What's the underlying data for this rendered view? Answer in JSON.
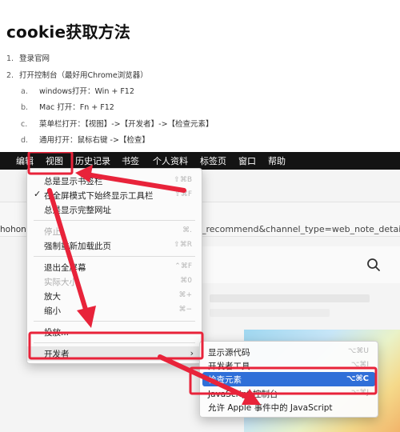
{
  "doc": {
    "title": "cookie获取方法",
    "steps": [
      {
        "num": "1.",
        "text": "登录官网"
      },
      {
        "num": "2.",
        "text": "打开控制台（最好用Chrome浏览器）"
      }
    ],
    "substeps": [
      {
        "num": "a.",
        "text": "windows打开：Win + F12"
      },
      {
        "num": "b.",
        "text": "Mac 打开：Fn + F12"
      },
      {
        "num": "c.",
        "text": "菜单栏打开：【视图】->【开发者】->【检查元素】"
      },
      {
        "num": "d.",
        "text": "通用打开：鼠标右键 ->【检查】"
      }
    ]
  },
  "menubar": {
    "items": [
      "编辑",
      "视图",
      "历史记录",
      "书签",
      "个人资料",
      "标签页",
      "窗口",
      "帮助"
    ]
  },
  "page": {
    "url_left": "hohon",
    "url_right": "_recommend&channel_type=web_note_detail"
  },
  "view_menu": {
    "items": [
      {
        "label": "总是显示书签栏",
        "shortcut": "⇧⌘B"
      },
      {
        "label": "在全屏模式下始终显示工具栏",
        "shortcut": "⇧⌘F",
        "checked": "✓"
      },
      {
        "label": "总是显示完整网址",
        "shortcut": ""
      },
      {
        "label": "停止",
        "shortcut": "⌘."
      },
      {
        "label": "强制重新加载此页",
        "shortcut": "⇧⌘R"
      },
      {
        "label": "退出全屏幕",
        "shortcut": "⌃⌘F"
      },
      {
        "label": "实际大小",
        "shortcut": "⌘0"
      },
      {
        "label": "放大",
        "shortcut": "⌘+"
      },
      {
        "label": "缩小",
        "shortcut": "⌘−"
      },
      {
        "label": "投放...",
        "shortcut": ""
      },
      {
        "label": "开发者",
        "shortcut": "",
        "chevron": "›"
      }
    ]
  },
  "dev_submenu": {
    "items": [
      {
        "label": "显示源代码",
        "shortcut": "⌥⌘U"
      },
      {
        "label": "开发者工具",
        "shortcut": "⌥⌘I"
      },
      {
        "label": "检查元素",
        "shortcut": "⌥⌘C"
      },
      {
        "label": "JavaScript 控制台",
        "shortcut": "⌥⌘J"
      },
      {
        "label": "允许 Apple 事件中的 JavaScript",
        "shortcut": ""
      }
    ]
  },
  "colors": {
    "annotation_red": "#e8233a",
    "highlight_blue": "#2f6fd8",
    "menubar_bg": "#141414"
  }
}
